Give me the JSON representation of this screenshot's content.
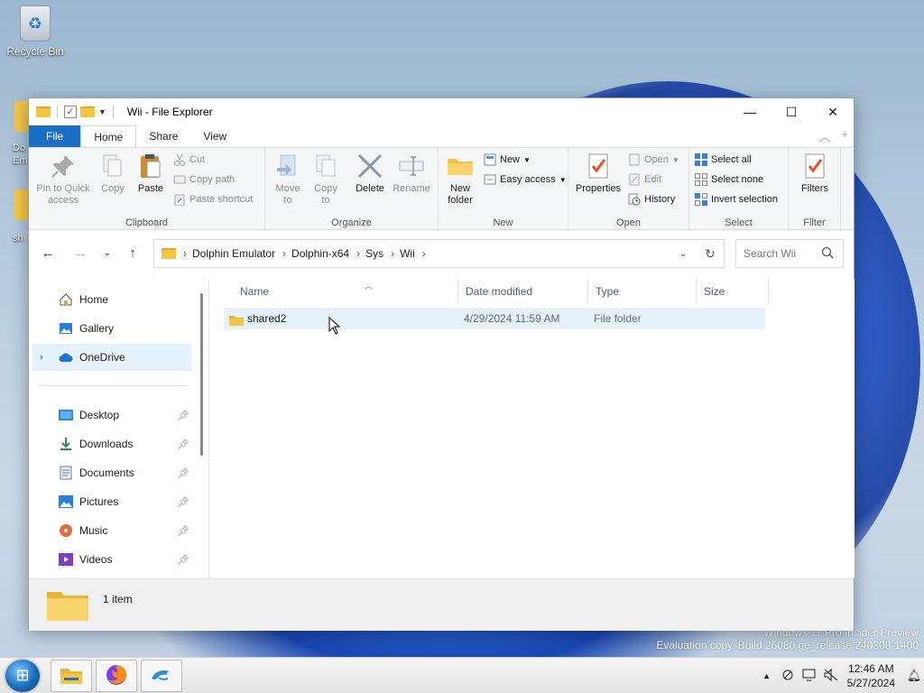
{
  "desktop": {
    "icons": [
      {
        "label": "Recycle Bin",
        "icon": "recycle-bin-icon"
      }
    ],
    "partial_labels": [
      "Do",
      "Em",
      "sh"
    ],
    "watermark": [
      "Windows 11 Pro Insider Preview",
      "Evaluation copy. Build 26080.ge_release.240308-1400"
    ]
  },
  "window": {
    "title": "Wii - File Explorer",
    "controls": {
      "minimize": "—",
      "maximize": "☐",
      "close": "✕"
    }
  },
  "ribbon": {
    "tabs": [
      "File",
      "Home",
      "Share",
      "View"
    ],
    "active_tab": "Home",
    "groups": {
      "clipboard": {
        "label": "Clipboard",
        "pin": "Pin to Quick access",
        "copy": "Copy",
        "paste": "Paste",
        "cut": "Cut",
        "copy_path": "Copy path",
        "paste_shortcut": "Paste shortcut"
      },
      "organize": {
        "label": "Organize",
        "move_to": "Move to",
        "copy_to": "Copy to",
        "delete": "Delete",
        "rename": "Rename"
      },
      "new": {
        "label": "New",
        "new_folder": "New folder",
        "new_item": "New",
        "easy_access": "Easy access"
      },
      "open": {
        "label": "Open",
        "properties": "Properties",
        "open": "Open",
        "edit": "Edit",
        "history": "History"
      },
      "select": {
        "label": "Select",
        "select_all": "Select all",
        "select_none": "Select none",
        "invert": "Invert selection"
      },
      "filter": {
        "label": "Filter",
        "filters": "Filters"
      }
    }
  },
  "address": {
    "breadcrumbs": [
      "Dolphin Emulator",
      "Dolphin-x64",
      "Sys",
      "Wii"
    ],
    "search_placeholder": "Search Wii"
  },
  "navpane": {
    "top": [
      {
        "label": "Home",
        "icon": "home-icon"
      },
      {
        "label": "Gallery",
        "icon": "gallery-icon"
      },
      {
        "label": "OneDrive",
        "icon": "cloud-icon"
      }
    ],
    "pinned": [
      {
        "label": "Desktop",
        "icon": "desktop-icon"
      },
      {
        "label": "Downloads",
        "icon": "download-icon"
      },
      {
        "label": "Documents",
        "icon": "documents-icon"
      },
      {
        "label": "Pictures",
        "icon": "pictures-icon"
      },
      {
        "label": "Music",
        "icon": "music-icon"
      },
      {
        "label": "Videos",
        "icon": "videos-icon"
      }
    ]
  },
  "filelist": {
    "columns": [
      "Name",
      "Date modified",
      "Type",
      "Size"
    ],
    "rows": [
      {
        "name": "shared2",
        "date": "4/29/2024 11:59 AM",
        "type": "File folder",
        "size": ""
      }
    ]
  },
  "statusbar": {
    "count": "1 item"
  },
  "taskbar": {
    "apps": [
      "file-explorer-icon",
      "firefox-icon",
      "dolphin-icon"
    ],
    "time": "12:46 AM",
    "date": "5/27/2024"
  },
  "colors": {
    "accent": "#1a6ec4",
    "folder": "#f4c542",
    "selection": "#e5f1fb"
  }
}
